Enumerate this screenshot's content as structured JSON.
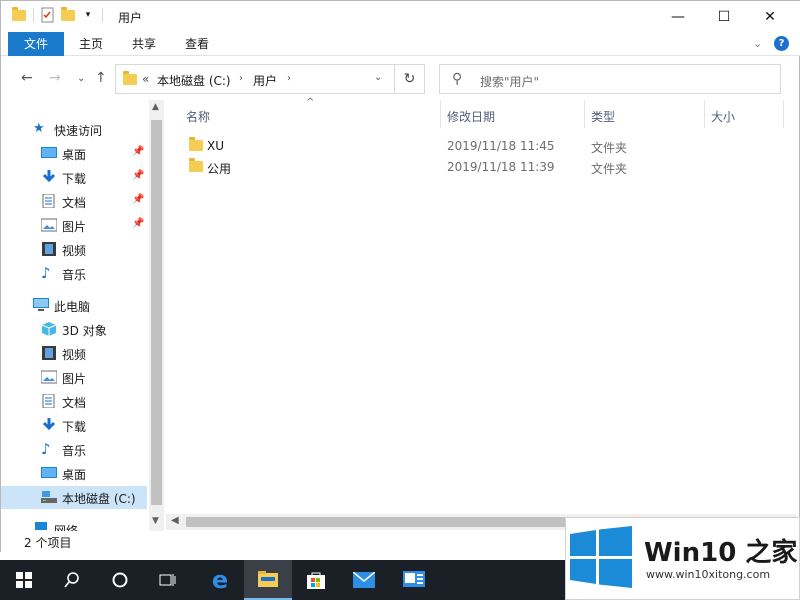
{
  "window": {
    "title": "用户",
    "controls": {
      "minimize": "—",
      "maximize": "☐",
      "close": "✕"
    }
  },
  "ribbon": {
    "tabs": [
      "文件",
      "主页",
      "共享",
      "查看"
    ]
  },
  "address": {
    "overflow": "«",
    "crumbs": [
      "本地磁盘 (C:)",
      "用户"
    ],
    "search_placeholder": "搜索\"用户\""
  },
  "sidebar": {
    "items": [
      {
        "label": "快速访问",
        "icon": "star-icon"
      },
      {
        "label": "桌面",
        "icon": "desktop-icon",
        "pinned": true
      },
      {
        "label": "下载",
        "icon": "download-icon",
        "pinned": true
      },
      {
        "label": "文档",
        "icon": "document-icon",
        "pinned": true
      },
      {
        "label": "图片",
        "icon": "pictures-icon",
        "pinned": true
      },
      {
        "label": "视频",
        "icon": "video-icon"
      },
      {
        "label": "音乐",
        "icon": "music-icon"
      },
      {
        "label": "此电脑",
        "icon": "computer-icon"
      },
      {
        "label": "3D 对象",
        "icon": "3d-objects-icon"
      },
      {
        "label": "视频",
        "icon": "video-icon"
      },
      {
        "label": "图片",
        "icon": "pictures-icon"
      },
      {
        "label": "文档",
        "icon": "document-icon"
      },
      {
        "label": "下载",
        "icon": "download-icon"
      },
      {
        "label": "音乐",
        "icon": "music-icon"
      },
      {
        "label": "桌面",
        "icon": "desktop-icon"
      },
      {
        "label": "本地磁盘 (C:)",
        "icon": "drive-icon",
        "selected": true
      },
      {
        "label": "网络",
        "icon": "network-icon"
      }
    ]
  },
  "columns": [
    "名称",
    "修改日期",
    "类型",
    "大小"
  ],
  "files": [
    {
      "name": "XU",
      "modified": "2019/11/18 11:45",
      "type": "文件夹"
    },
    {
      "name": "公用",
      "modified": "2019/11/18 11:39",
      "type": "文件夹"
    }
  ],
  "status": {
    "item_count": "2 个项目"
  },
  "watermark": {
    "brand": "Win10 之家",
    "url": "www.win10xitong.com"
  },
  "colors": {
    "accent": "#1979ca",
    "folder": "#f5cd55",
    "selection": "#cce4f7",
    "taskbar": "#1b1f26"
  }
}
